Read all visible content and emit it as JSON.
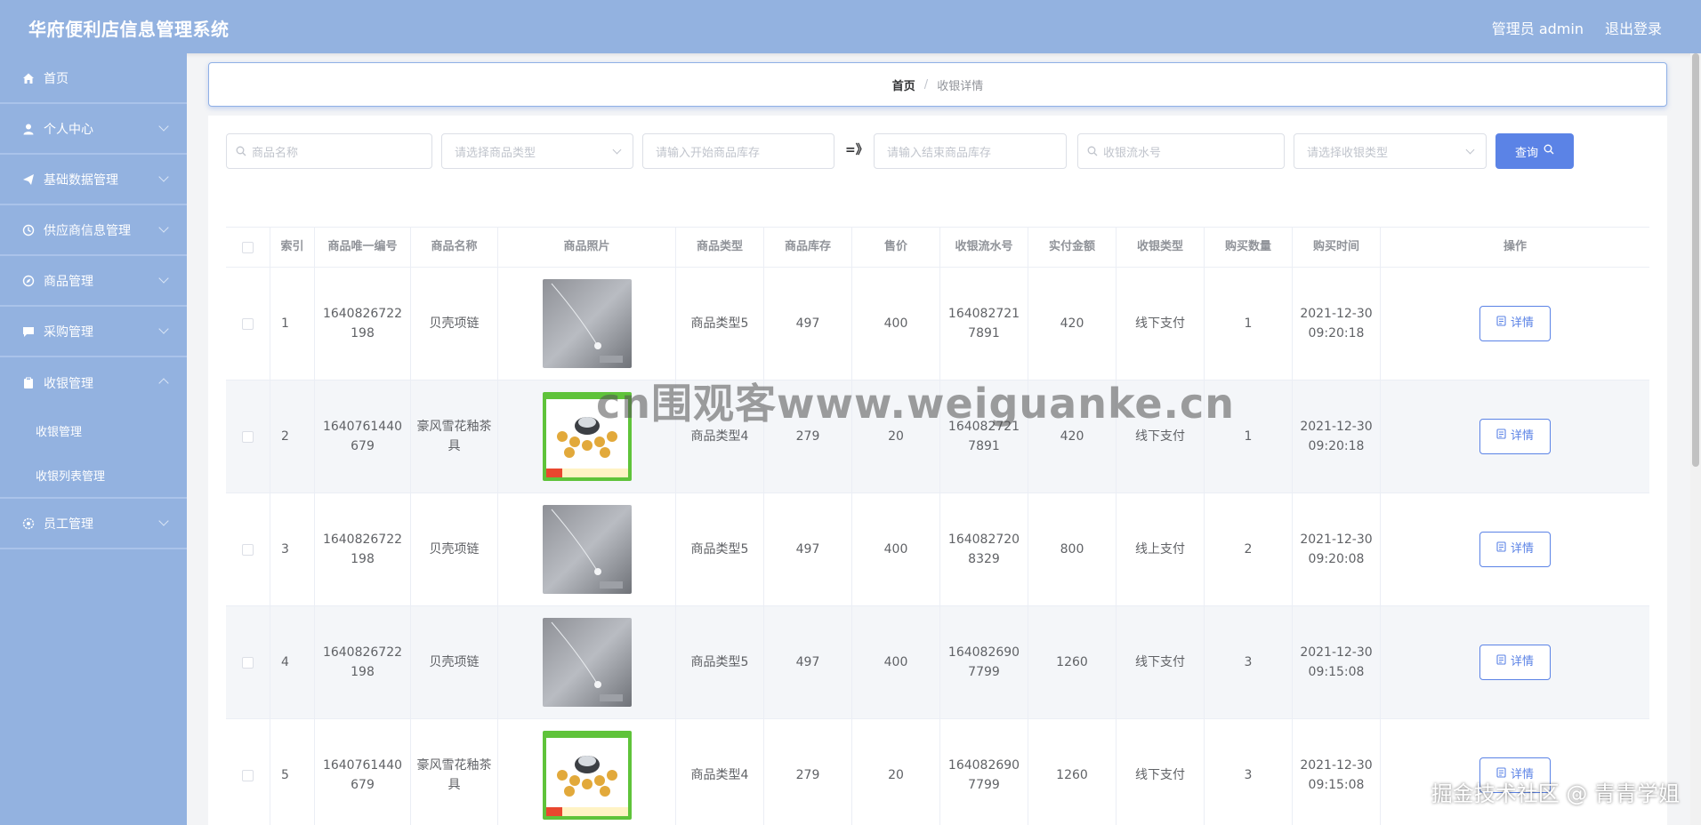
{
  "header": {
    "title": "华府便利店信息管理系统",
    "user": "管理员 admin",
    "logout": "退出登录"
  },
  "sidebar": {
    "items": [
      {
        "label": "首页",
        "icon": "home-icon"
      },
      {
        "label": "个人中心",
        "icon": "user-icon"
      },
      {
        "label": "基础数据管理",
        "icon": "paper-plane-icon"
      },
      {
        "label": "供应商信息管理",
        "icon": "clock-icon"
      },
      {
        "label": "商品管理",
        "icon": "compass-icon"
      },
      {
        "label": "采购管理",
        "icon": "message-icon"
      },
      {
        "label": "收银管理",
        "icon": "receipt-icon",
        "children": [
          "收银管理",
          "收银列表管理"
        ]
      },
      {
        "label": "员工管理",
        "icon": "gear-icon"
      }
    ]
  },
  "breadcrumb": {
    "home": "首页",
    "separator": "/",
    "current": "收银详情"
  },
  "search": {
    "name_placeholder": "商品名称",
    "type_placeholder": "请选择商品类型",
    "stock_start_placeholder": "请输入开始商品库存",
    "range_sep": "=》",
    "stock_end_placeholder": "请输入结束商品库存",
    "serial_placeholder": "收银流水号",
    "pay_type_placeholder": "请选择收银类型",
    "query_label": "查询"
  },
  "table": {
    "headers": [
      "索引",
      "商品唯一编号",
      "商品名称",
      "商品照片",
      "商品类型",
      "商品库存",
      "售价",
      "收银流水号",
      "实付金额",
      "收银类型",
      "购买数量",
      "购买时间",
      "操作"
    ],
    "detail_label": "详情",
    "rows": [
      {
        "index": "1",
        "code": "1640826722198",
        "name": "贝壳项链",
        "photo": "necklace",
        "type": "商品类型5",
        "stock": "497",
        "price": "400",
        "serial": "1640827217891",
        "paid": "420",
        "pay_type": "线下支付",
        "qty": "1",
        "time": "2021-12-30 09:20:18"
      },
      {
        "index": "2",
        "code": "1640761440679",
        "name": "豪风雪花釉茶具",
        "photo": "teaset",
        "type": "商品类型4",
        "stock": "279",
        "price": "20",
        "serial": "1640827217891",
        "paid": "420",
        "pay_type": "线下支付",
        "qty": "1",
        "time": "2021-12-30 09:20:18"
      },
      {
        "index": "3",
        "code": "1640826722198",
        "name": "贝壳项链",
        "photo": "necklace",
        "type": "商品类型5",
        "stock": "497",
        "price": "400",
        "serial": "1640827208329",
        "paid": "800",
        "pay_type": "线上支付",
        "qty": "2",
        "time": "2021-12-30 09:20:08"
      },
      {
        "index": "4",
        "code": "1640826722198",
        "name": "贝壳项链",
        "photo": "necklace",
        "type": "商品类型5",
        "stock": "497",
        "price": "400",
        "serial": "1640826907799",
        "paid": "1260",
        "pay_type": "线下支付",
        "qty": "3",
        "time": "2021-12-30 09:15:08"
      },
      {
        "index": "5",
        "code": "1640761440679",
        "name": "豪风雪花釉茶具",
        "photo": "teaset",
        "type": "商品类型4",
        "stock": "279",
        "price": "20",
        "serial": "1640826907799",
        "paid": "1260",
        "pay_type": "线下支付",
        "qty": "3",
        "time": "2021-12-30 09:15:08"
      }
    ]
  },
  "overlays": {
    "watermark": "cn围观客www.weiguanke.cn",
    "corner": "掘金技术社区 @ 青青学姐"
  },
  "colors": {
    "primary": "#5b83e6",
    "sidebar": "#93b2e0",
    "header": "#93b2e0"
  }
}
